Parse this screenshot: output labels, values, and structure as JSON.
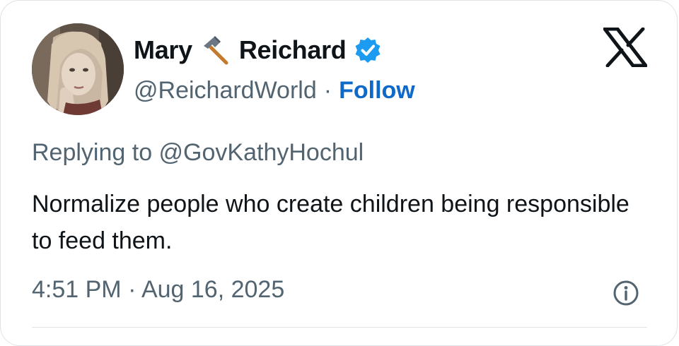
{
  "author": {
    "name_first": "Mary",
    "name_emoji": "hammer-icon",
    "name_last": "Reichard",
    "verified_badge": "verified-badge-icon",
    "handle": "@ReichardWorld",
    "separator": "·",
    "follow_label": "Follow"
  },
  "tweet": {
    "replying_to": "Replying to @GovKathyHochul",
    "text": "Normalize people who create children being responsible to feed them.",
    "timestamp": "4:51 PM · Aug 16, 2025"
  },
  "icons": {
    "platform_logo": "x-logo-icon",
    "info": "info-icon"
  },
  "colors": {
    "follow_blue": "#0f69c9",
    "verified_blue": "#1d9bf0",
    "secondary_text": "#536471",
    "primary_text": "#0f1419"
  }
}
